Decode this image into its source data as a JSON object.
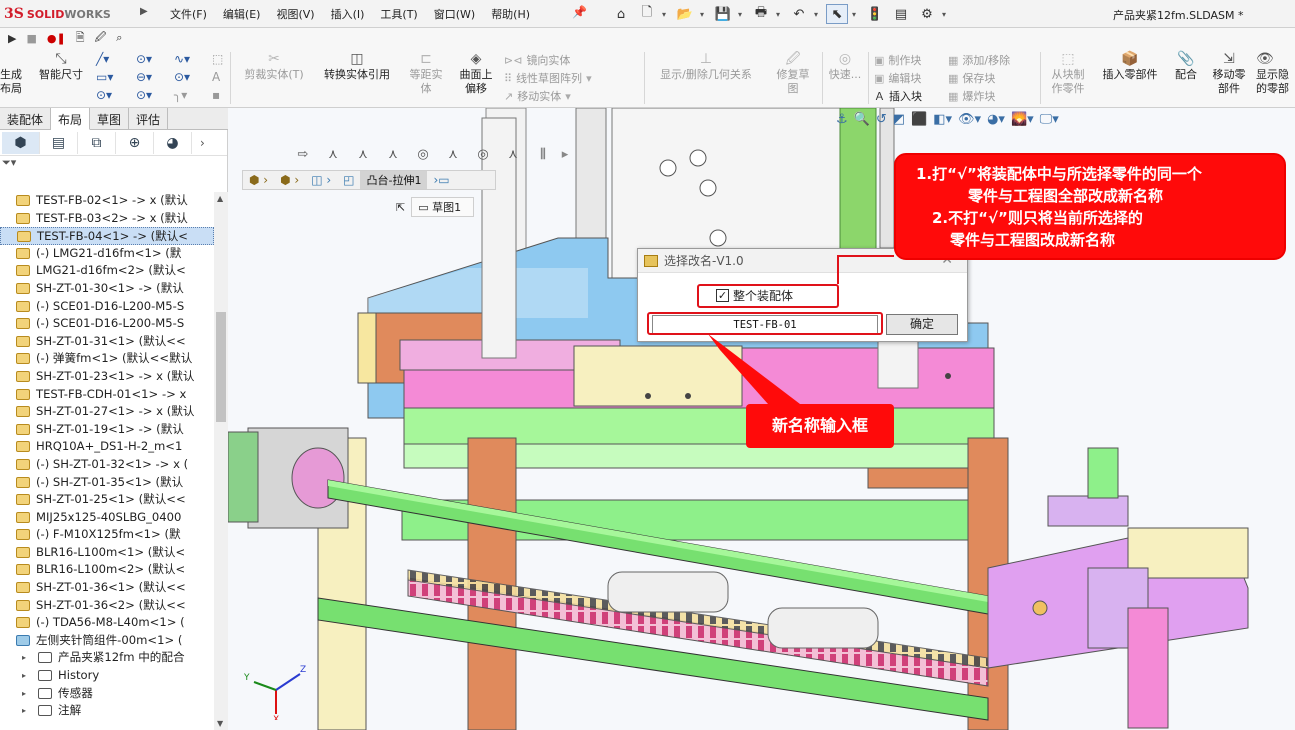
{
  "app": {
    "brand_ds": "3S",
    "brand_solid": "SOLID",
    "brand_works": "WORKS",
    "document_title": "产品夹紧12fm.SLDASM *"
  },
  "menu": [
    "文件(F)",
    "编辑(E)",
    "视图(V)",
    "插入(I)",
    "工具(T)",
    "窗口(W)",
    "帮助(H)"
  ],
  "ribbon": {
    "generate_layout": [
      "生成",
      "布局"
    ],
    "smart_dimension": "智能尺寸",
    "trim_entities": "剪裁实体(T)",
    "convert_entities": "转换实体引用",
    "offset_entities": [
      "等距实",
      "体"
    ],
    "offset_on_surface": [
      "曲面上",
      "偏移"
    ],
    "mirror_entities": "镜向实体",
    "linear_pattern": "线性草图阵列",
    "move_entities": "移动实体",
    "show_delete_relations": "显示/删除几何关系",
    "repair_sketch": [
      "修复草",
      "图"
    ],
    "quick": "快速...",
    "make_block": "制作块",
    "edit_block": "编辑块",
    "insert_block": "插入块",
    "add_remove": "添加/移除",
    "save_block": "保存块",
    "explode_block": "爆炸块",
    "make_part_from_block": [
      "从块制",
      "作零件"
    ],
    "insert_part": "插入零部件",
    "mate": "配合",
    "move_component": [
      "移动零",
      "部件"
    ],
    "show_hidden": [
      "显示隐",
      "的零部"
    ]
  },
  "tabs": [
    "装配体",
    "布局",
    "草图",
    "评估"
  ],
  "active_tab": "布局",
  "tree": {
    "items": [
      {
        "label": "TEST-FB-02<1> -> x (默认",
        "type": "part"
      },
      {
        "label": "TEST-FB-03<2> -> x (默认",
        "type": "part"
      },
      {
        "label": "TEST-FB-04<1> -> (默认<",
        "type": "part",
        "selected": true
      },
      {
        "label": "(-) LMG21-d16fm<1> (默",
        "type": "part"
      },
      {
        "label": "LMG21-d16fm<2> (默认<",
        "type": "part"
      },
      {
        "label": "SH-ZT-01-30<1> -> (默认",
        "type": "part"
      },
      {
        "label": "(-) SCE01-D16-L200-M5-S",
        "type": "part"
      },
      {
        "label": "(-) SCE01-D16-L200-M5-S",
        "type": "part"
      },
      {
        "label": "SH-ZT-01-31<1> (默认<<",
        "type": "part"
      },
      {
        "label": "(-) 弹簧fm<1> (默认<<默认",
        "type": "part"
      },
      {
        "label": "SH-ZT-01-23<1> -> x (默认",
        "type": "part"
      },
      {
        "label": "TEST-FB-CDH-01<1> -> x",
        "type": "part"
      },
      {
        "label": "SH-ZT-01-27<1> -> x (默认",
        "type": "part"
      },
      {
        "label": "SH-ZT-01-19<1> -> (默认",
        "type": "part"
      },
      {
        "label": "HRQ10A+_DS1-H-2_m<1",
        "type": "part"
      },
      {
        "label": "(-) SH-ZT-01-32<1> -> x (",
        "type": "part"
      },
      {
        "label": "(-) SH-ZT-01-35<1> (默认",
        "type": "part"
      },
      {
        "label": "SH-ZT-01-25<1> (默认<<",
        "type": "part"
      },
      {
        "label": "MIJ25x125-40SLBG_0400",
        "type": "part"
      },
      {
        "label": "(-) F-M10X125fm<1> (默",
        "type": "part"
      },
      {
        "label": "BLR16-L100m<1> (默认<",
        "type": "part"
      },
      {
        "label": "BLR16-L100m<2> (默认<",
        "type": "part"
      },
      {
        "label": "SH-ZT-01-36<1> (默认<<",
        "type": "part"
      },
      {
        "label": "SH-ZT-01-36<2> (默认<<",
        "type": "part"
      },
      {
        "label": "(-) TDA56-M8-L40m<1> (",
        "type": "part"
      },
      {
        "label": "左侧夹针筒组件-00m<1> (",
        "type": "assembly"
      },
      {
        "label": "产品夹紧12fm 中的配合",
        "type": "mates",
        "sub": true
      },
      {
        "label": "History",
        "type": "history",
        "sub": true
      },
      {
        "label": "传感器",
        "type": "sensor",
        "sub": true
      },
      {
        "label": "注解",
        "type": "annot",
        "sub": true
      }
    ]
  },
  "viewport": {
    "breadcrumb_feature": "凸台-拉伸1",
    "breadcrumb_sketch": "草图1"
  },
  "dialog": {
    "title": "选择改名-V1.0",
    "checkbox_label": "整个装配体",
    "checkbox_checked": true,
    "input_value": "TEST-FB-01",
    "ok_label": "确定"
  },
  "annotations": {
    "note_line1": "1.打“√”将装配体中与所选择零件的同一个",
    "note_line2": "零件与工程图全部改成新名称",
    "note_line3": "2.不打“√”则只将当前所选择的",
    "note_line4": "零件与工程图改成新名称",
    "callout": "新名称输入框",
    "accent_color": "#ff0a0a"
  },
  "triad": {
    "x": "X",
    "y": "Y",
    "z": "Z"
  }
}
